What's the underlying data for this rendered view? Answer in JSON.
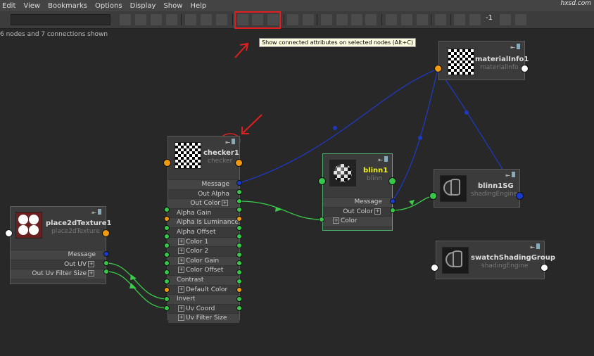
{
  "menu": {
    "items": [
      "Edit",
      "View",
      "Bookmarks",
      "Options",
      "Display",
      "Show",
      "Help"
    ]
  },
  "logo": "hxsd.com",
  "toolbar": {
    "value_text": "-1"
  },
  "status": {
    "text": "6 nodes and 7 connections shown"
  },
  "tooltip": {
    "text": "Show connected attributes on selected nodes (Alt+C)"
  },
  "nodes": {
    "checker": {
      "name": "checker1",
      "type": "checker",
      "outputs": [
        "Message",
        "Out Alpha",
        "Out Color"
      ],
      "inputs": [
        "Alpha Gain",
        "Alpha Is Luminance",
        "Alpha Offset",
        "Color 1",
        "Color 2",
        "Color Gain",
        "Color Offset",
        "Contrast",
        "Default Color",
        "Invert",
        "Uv Coord",
        "Uv Filter Size"
      ]
    },
    "place2d": {
      "name": "place2dTexture1",
      "type": "place2dTexture",
      "outputs": [
        "Message",
        "Out UV",
        "Out Uv Filter Size"
      ]
    },
    "blinn": {
      "name": "blinn1",
      "type": "blinn",
      "outputs": [
        "Message",
        "Out Color"
      ],
      "inputs": [
        "Color"
      ]
    },
    "materialInfo": {
      "name": "materialInfo1",
      "type": "materialInfo"
    },
    "blinnSG": {
      "name": "blinn1SG",
      "type": "shadingEngine"
    },
    "swatchSG": {
      "name": "swatchShadingGroup",
      "type": "shadingEngine"
    }
  },
  "colors": {
    "accent_red": "#e02020",
    "conn_green": "#3ccc4a",
    "conn_blue": "#2038c0",
    "selected_border": "#4fae6e"
  }
}
